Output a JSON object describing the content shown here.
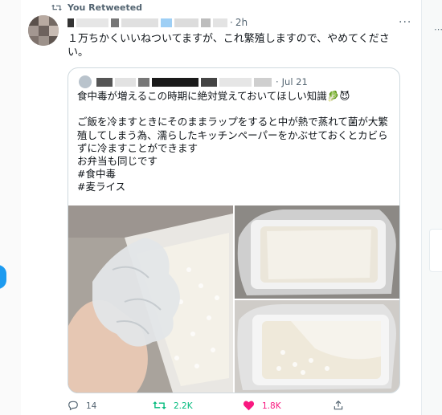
{
  "retweet_header": {
    "label": "You Retweeted",
    "icon": "retweet-icon"
  },
  "tweet": {
    "time": "2h",
    "text": "１万ちかくいいねついてますが、これ繁殖しますので、やめてください。"
  },
  "quoted_tweet": {
    "date": "Jul 21",
    "text": "食中毒が増えるこの時期に絶対覚えておいてほしい知識🥬😈\n\nご飯を冷ますときにそのままラップをすると中が熱で蒸れて菌が大繁殖してしまう為、濡らしたキッチンペーパーをかぶせておくとカビらずに冷ますことができます\nお弁当も同じです\n#食中毒\n#麦ライス"
  },
  "actions": {
    "reply_count": "14",
    "retweet_count": "2.2K",
    "like_count": "1.8K"
  },
  "colors": {
    "retweet_green": "#00ba7c",
    "like_pink": "#f91880",
    "accent_blue": "#1d9bf0",
    "muted_gray": "#536471"
  }
}
